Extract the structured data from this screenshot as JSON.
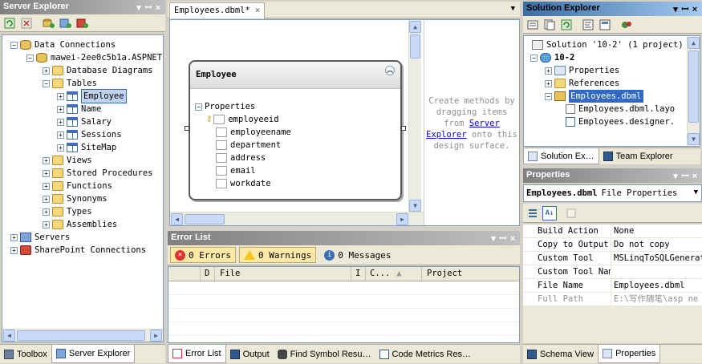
{
  "server_explorer": {
    "title": "Server Explorer",
    "btn_pin": "ꟷ",
    "btn_pin2": "ф",
    "btn_close": "×",
    "tree": {
      "data_connections": "Data Connections",
      "connection": "mawei-2ee0c5b1a.ASPNET",
      "database_diagrams": "Database Diagrams",
      "tables": "Tables",
      "tables_items": [
        "Employee",
        "Name",
        "Salary",
        "Sessions",
        "SiteMap"
      ],
      "views": "Views",
      "stored_procedures": "Stored Procedures",
      "functions": "Functions",
      "synonyms": "Synonyms",
      "types": "Types",
      "assemblies": "Assemblies",
      "servers": "Servers",
      "sharepoint": "SharePoint Connections"
    },
    "tabs": {
      "toolbox": "Toolbox",
      "server_explorer": "Server Explorer"
    }
  },
  "designer": {
    "tab_label": "Employees.dbml*",
    "entity": {
      "name": "Employee",
      "section": "Properties",
      "properties": [
        "employeeid",
        "employeename",
        "department",
        "address",
        "email",
        "workdate"
      ]
    },
    "methods_hint_1": "Create methods by",
    "methods_hint_2": "dragging items",
    "methods_hint_3": "from",
    "methods_link": "Server",
    "methods_link_2": "Explorer",
    "methods_hint_4": "onto this",
    "methods_hint_5": "design surface."
  },
  "error_list": {
    "title": "Error List",
    "errors": "0 Errors",
    "warnings": "0 Warnings",
    "messages": "0 Messages",
    "columns": [
      "",
      "D",
      "File",
      "I",
      "C...",
      "Project"
    ]
  },
  "bottom_tabs": {
    "error_list": "Error List",
    "output": "Output",
    "find_symbol": "Find Symbol Resu…",
    "code_metrics": "Code Metrics Res…"
  },
  "solution_explorer": {
    "title": "Solution Explorer",
    "solution": "Solution '10-2' (1 project)",
    "project": "10-2",
    "properties": "Properties",
    "references": "References",
    "dbml": "Employees.dbml",
    "layout": "Employees.dbml.layo",
    "designer": "Employees.designer.",
    "tabs": {
      "solution": "Solution Ex…",
      "team": "Team Explorer"
    }
  },
  "properties_panel": {
    "title": "Properties",
    "object_name": "Employees.dbml",
    "object_type": "File Properties",
    "rows": [
      {
        "name": "Build Action",
        "value": "None"
      },
      {
        "name": "Copy to Output",
        "value": "Do not copy"
      },
      {
        "name": "Custom Tool",
        "value": "MSLinqToSQLGenerat"
      },
      {
        "name": "Custom Tool Nam",
        "value": ""
      },
      {
        "name": "File Name",
        "value": "Employees.dbml"
      },
      {
        "name": "Full Path",
        "value": "E:\\写作随笔\\asp ne"
      }
    ],
    "tabs": {
      "schema": "Schema View",
      "properties": "Properties"
    }
  },
  "colors": {
    "active_title": "#3a6ea5",
    "inactive_title": "#808080",
    "link": "#0000ee",
    "hint": "#8e8e8e"
  }
}
